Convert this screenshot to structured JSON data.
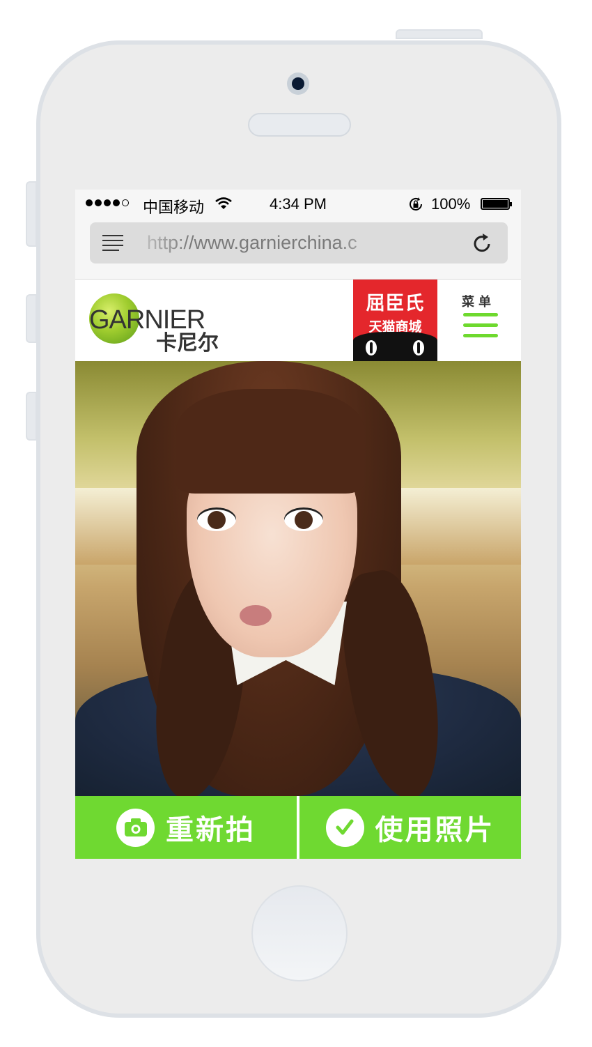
{
  "status_bar": {
    "carrier": "中国移动",
    "time": "4:34 PM",
    "battery": "100%"
  },
  "browser": {
    "url": "http://www.garnierchina.c"
  },
  "header": {
    "logo_wordmark": "GARNIER",
    "logo_chinese": "卡尼尔",
    "tmall_title": "屈臣氏",
    "tmall_subtitle": "天猫商城",
    "menu_label": "菜单"
  },
  "actions": {
    "retake_label": "重新拍",
    "use_photo_label": "使用照片"
  },
  "colors": {
    "accent_green": "#6fd931",
    "tmall_red": "#e4272c"
  }
}
